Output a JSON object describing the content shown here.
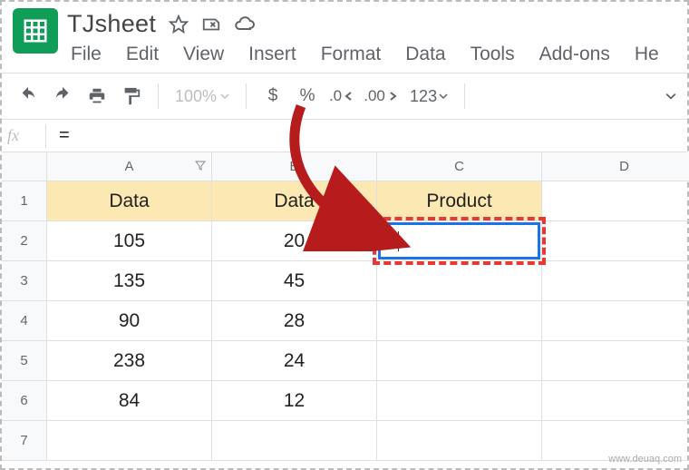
{
  "doc": {
    "name": "TJsheet"
  },
  "menus": [
    "File",
    "Edit",
    "View",
    "Insert",
    "Format",
    "Data",
    "Tools",
    "Add-ons",
    "He"
  ],
  "toolbar": {
    "zoom": "100%",
    "currency": "$",
    "percent": "%",
    "dec_dec": ".0",
    "inc_dec": ".00",
    "num_fmt": "123"
  },
  "formula_bar": {
    "value": "="
  },
  "columns": [
    "A",
    "B",
    "C",
    "D"
  ],
  "rows": [
    "1",
    "2",
    "3",
    "4",
    "5",
    "6",
    "7"
  ],
  "grid": {
    "r1": {
      "a": "Data",
      "b": "Data",
      "c": "Product",
      "d": ""
    },
    "r2": {
      "a": "105",
      "b": "20",
      "c": "=",
      "d": ""
    },
    "r3": {
      "a": "135",
      "b": "45",
      "c": "",
      "d": ""
    },
    "r4": {
      "a": "90",
      "b": "28",
      "c": "",
      "d": ""
    },
    "r5": {
      "a": "238",
      "b": "24",
      "c": "",
      "d": ""
    },
    "r6": {
      "a": "84",
      "b": "12",
      "c": "",
      "d": ""
    },
    "r7": {
      "a": "",
      "b": "",
      "c": "",
      "d": ""
    }
  },
  "watermark": "www.deuaq.com",
  "chart_data": {
    "type": "table",
    "columns": [
      "Data",
      "Data",
      "Product"
    ],
    "rows": [
      [
        105,
        20,
        null
      ],
      [
        135,
        45,
        null
      ],
      [
        90,
        28,
        null
      ],
      [
        238,
        24,
        null
      ],
      [
        84,
        12,
        null
      ]
    ]
  }
}
